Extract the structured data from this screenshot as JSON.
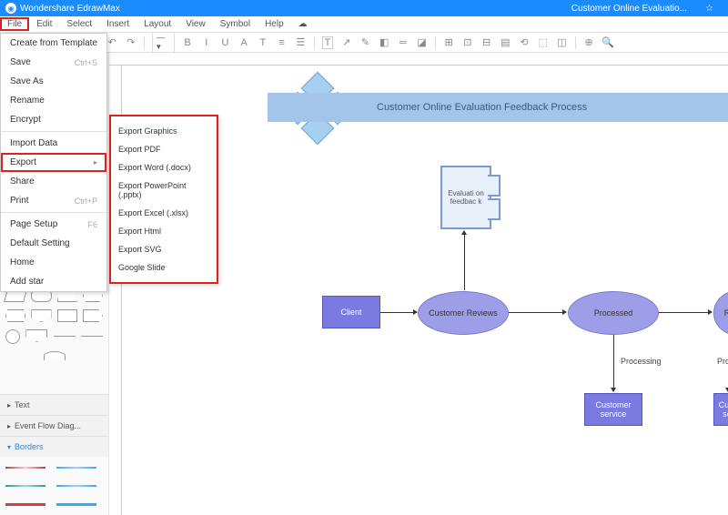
{
  "app": {
    "name": "Wondershare EdrawMax",
    "doc_title": "Customer Online Evaluatio..."
  },
  "menubar": [
    "File",
    "Edit",
    "Select",
    "Insert",
    "Layout",
    "View",
    "Symbol",
    "Help"
  ],
  "toolbar": {
    "font_size": "— ▾"
  },
  "file_menu": {
    "items": [
      {
        "label": "Create from Template",
        "shortcut": ""
      },
      {
        "label": "Save",
        "shortcut": "Ctrl+S"
      },
      {
        "label": "Save As",
        "shortcut": ""
      },
      {
        "label": "Rename",
        "shortcut": ""
      },
      {
        "label": "Encrypt",
        "shortcut": ""
      }
    ],
    "items2": [
      {
        "label": "Import Data",
        "shortcut": ""
      },
      {
        "label": "Export",
        "shortcut": "",
        "submenu": true,
        "highlighted": true
      },
      {
        "label": "Share",
        "shortcut": ""
      },
      {
        "label": "Print",
        "shortcut": "Ctrl+P"
      }
    ],
    "items3": [
      {
        "label": "Page Setup",
        "shortcut": "F6"
      },
      {
        "label": "Default Setting",
        "shortcut": ""
      },
      {
        "label": "Home",
        "shortcut": ""
      },
      {
        "label": "Add star",
        "shortcut": ""
      }
    ]
  },
  "export_menu": [
    "Export Graphics",
    "Export PDF",
    "Export Word (.docx)",
    "Export PowerPoint (.pptx)",
    "Export Excel (.xlsx)",
    "Export Html",
    "Export SVG",
    "Google Slide"
  ],
  "sidebar": {
    "sections": {
      "text": "Text",
      "eventflow": "Event Flow Diag...",
      "borders": "Borders"
    }
  },
  "diagram": {
    "title": "Customer Online Evaluation Feedback Process",
    "e_text": "Evaluati on feedbac k",
    "nodes": {
      "client": "Client",
      "reviews": "Customer Reviews",
      "processed": "Processed",
      "r_partial": "R",
      "customer_service": "Customer service",
      "cust_partial": "Cust se",
      "processing": "Processing",
      "proce_partial": "Proce"
    }
  }
}
